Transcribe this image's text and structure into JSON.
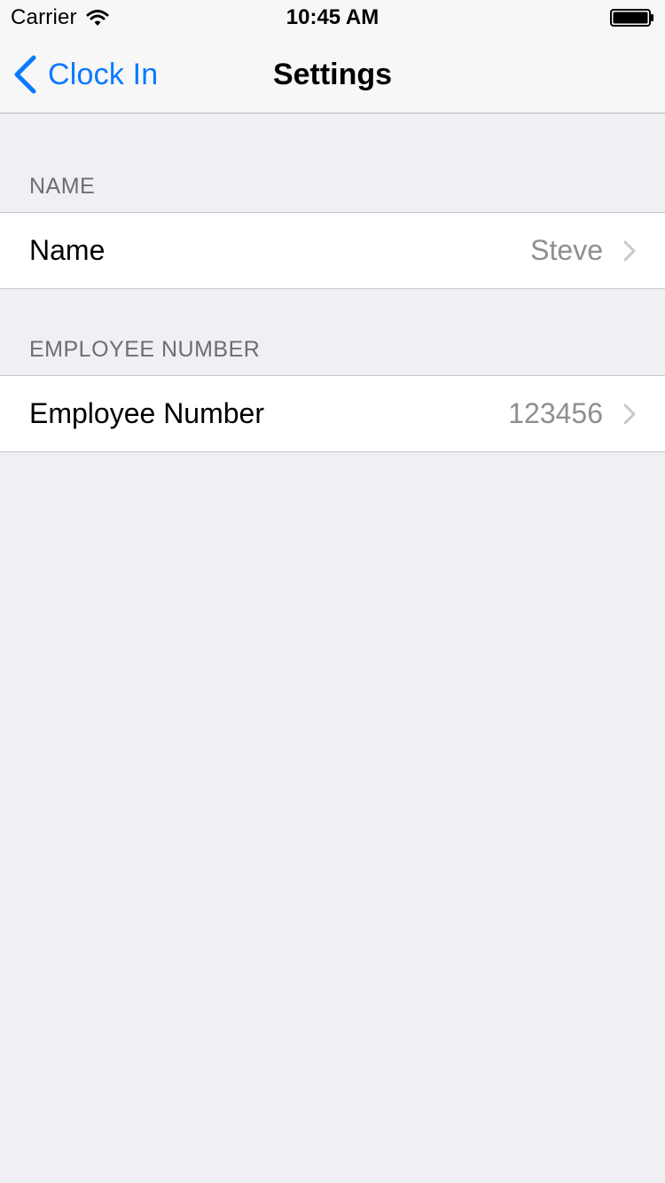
{
  "status_bar": {
    "carrier": "Carrier",
    "time": "10:45 AM",
    "icons": [
      "wifi-icon",
      "battery-icon"
    ]
  },
  "nav_bar": {
    "back_label": "Clock In",
    "title": "Settings",
    "back_icon": "chevron-left-icon"
  },
  "sections": [
    {
      "header": "NAME",
      "row": {
        "label": "Name",
        "value": "Steve"
      }
    },
    {
      "header": "EMPLOYEE NUMBER",
      "row": {
        "label": "Employee Number",
        "value": "123456"
      }
    }
  ],
  "colors": {
    "accent": "#0a7aff",
    "background": "#efeff4",
    "secondary_text": "#8e8e93",
    "section_header_text": "#6d6d72"
  }
}
